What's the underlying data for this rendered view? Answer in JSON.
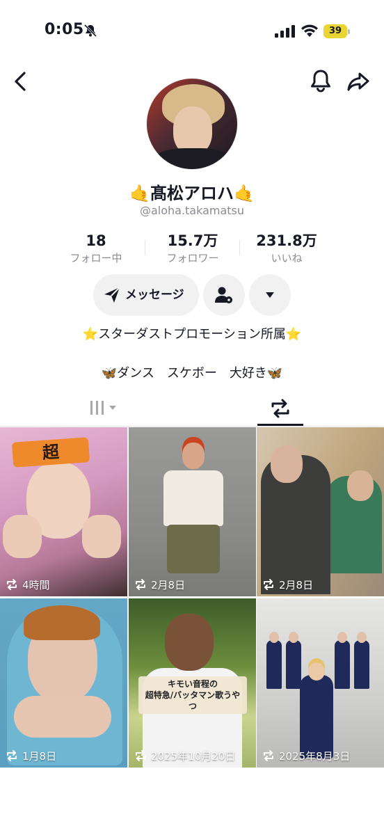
{
  "status_bar": {
    "time": "0:05",
    "battery": "39"
  },
  "profile": {
    "display_name": "🤙髙松アロハ🤙",
    "username": "@aloha.takamatsu",
    "stats": [
      {
        "number": "18",
        "label": "フォロー中"
      },
      {
        "number": "15.7万",
        "label": "フォロワー"
      },
      {
        "number": "231.8万",
        "label": "いいね"
      }
    ],
    "bio_lines": [
      "⭐️スターダストプロモーション所属⭐️",
      "🦋ダンス　スケボー　大好き🦋"
    ]
  },
  "actions": {
    "message_label": "メッセージ"
  },
  "videos": [
    {
      "meta": "4時間",
      "overlay": "超"
    },
    {
      "meta": "2月8日"
    },
    {
      "meta": "2月8日"
    },
    {
      "meta": "1月8日"
    },
    {
      "meta": "2025年10月20日",
      "caption_line1": "キモい音程の",
      "caption_line2": "超特急/バッタマン歌うやつ"
    },
    {
      "meta": "2025年8月3日"
    }
  ],
  "colors": {
    "text": "#161823",
    "secondary_text": "#8a8b91",
    "button_bg": "#f1f1f2",
    "battery": "#e8d534"
  }
}
